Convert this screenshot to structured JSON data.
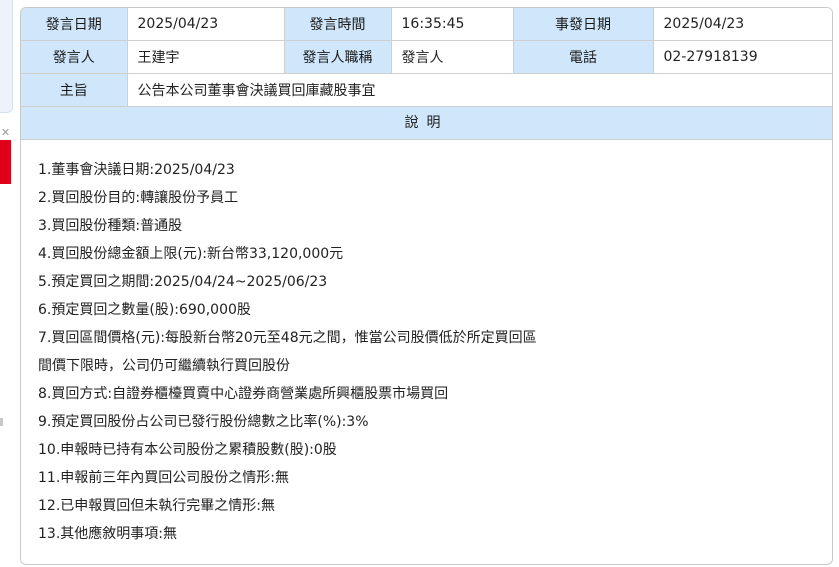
{
  "header": {
    "publish_date_label": "發言日期",
    "publish_date": "2025/04/23",
    "publish_time_label": "發言時間",
    "publish_time": "16:35:45",
    "event_date_label": "事發日期",
    "event_date": "2025/04/23",
    "speaker_label": "發言人",
    "speaker": "王建宇",
    "speaker_title_label": "發言人職稱",
    "speaker_title": "發言人",
    "phone_label": "電話",
    "phone": "02-27918139",
    "subject_label": "主旨",
    "subject": "公告本公司董事會決議買回庫藏股事宜"
  },
  "description": {
    "heading": "說明",
    "items": [
      "1.董事會決議日期:2025/04/23",
      "2.買回股份目的:轉讓股份予員工",
      "3.買回股份種類:普通股",
      "4.買回股份總金額上限(元):新台幣33,120,000元",
      "5.預定買回之期間:2025/04/24~2025/06/23",
      "6.預定買回之數量(股):690,000股",
      "7.買回區間價格(元):每股新台幣20元至48元之間，惟當公司股價低於所定買回區間價下限時，公司仍可繼續執行買回股份",
      "8.買回方式:自證券櫃檯買賣中心證券商營業處所興櫃股票市場買回",
      "9.預定買回股份占公司已發行股份總數之比率(%):3%",
      "10.申報時已持有本公司股份之累積股數(股):0股",
      "11.申報前三年內買回公司股份之情形:無",
      "12.已申報買回但未執行完畢之情形:無",
      "13.其他應敘明事項:無"
    ]
  },
  "side": {
    "close_glyph": "✕"
  },
  "colors": {
    "label_bg": "#cfe6fb",
    "border": "#cfcfcf",
    "ad_red": "#e0001a"
  }
}
